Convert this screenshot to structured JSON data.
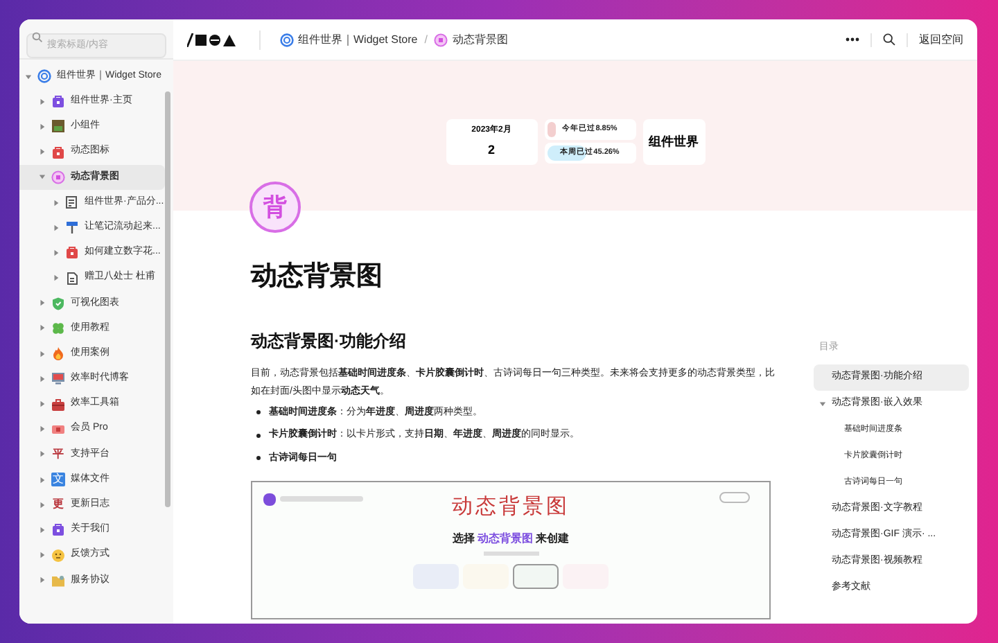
{
  "sidebar": {
    "search_placeholder": "搜索标题/内容",
    "tree": [
      {
        "label": "组件世界｜Widget Store",
        "expanded": true,
        "selected": false,
        "children": [
          {
            "label": "组件世界·主页",
            "expanded": false,
            "selected": false
          },
          {
            "label": "小组件",
            "expanded": false,
            "selected": false
          },
          {
            "label": "动态图标",
            "expanded": false,
            "selected": false
          },
          {
            "label": "动态背景图",
            "expanded": true,
            "selected": true,
            "children": [
              {
                "label": "组件世界·产品分...",
                "expanded": false,
                "selected": false
              },
              {
                "label": "让笔记流动起来...",
                "expanded": false,
                "selected": false
              },
              {
                "label": "如何建立数字花...",
                "expanded": false,
                "selected": false
              },
              {
                "label": "赠卫八处士 杜甫",
                "expanded": false,
                "selected": false
              }
            ]
          },
          {
            "label": "可视化图表",
            "expanded": false,
            "selected": false
          },
          {
            "label": "使用教程",
            "expanded": false,
            "selected": false
          },
          {
            "label": "使用案例",
            "expanded": false,
            "selected": false
          },
          {
            "label": "效率时代博客",
            "expanded": false,
            "selected": false
          },
          {
            "label": "效率工具箱",
            "expanded": false,
            "selected": false
          },
          {
            "label": "会员 Pro",
            "expanded": false,
            "selected": false
          },
          {
            "label": "支持平台",
            "glyph": "平",
            "expanded": false,
            "selected": false
          },
          {
            "label": "媒体文件",
            "glyph": "文",
            "expanded": false,
            "selected": false
          },
          {
            "label": "更新日志",
            "glyph": "更",
            "expanded": false,
            "selected": false
          },
          {
            "label": "关于我们",
            "expanded": false,
            "selected": false
          },
          {
            "label": "反馈方式",
            "expanded": false,
            "selected": false
          },
          {
            "label": "服务协议",
            "expanded": false,
            "selected": false
          }
        ]
      }
    ]
  },
  "topbar": {
    "breadcrumb": [
      "组件世界｜Widget Store",
      "动态背景图"
    ],
    "separator": "/",
    "back_button": "返回空间"
  },
  "cover": {
    "date": {
      "month": "2023年2月",
      "day": "2"
    },
    "progress": [
      {
        "label": "今年已过8.85%",
        "level": 0.0885
      },
      {
        "label": "本周已过45.26%",
        "level": 0.4526
      }
    ],
    "brand": "组件世界"
  },
  "page": {
    "icon_glyph": "背",
    "title": "动态背景图",
    "heading": "动态背景图·功能介绍",
    "intro": "目前，动态背景包括**基础时间进度条**、**卡片胶囊倒计时**、古诗词每日一句三种类型。未来将会支持更多的动态背景类型，比如在封面/头图中显示**动态天气**。",
    "bullets": [
      "**基础时间进度条**：分为**年进度**、**周进度**两种类型。",
      "**卡片胶囊倒计时**：以卡片形式，支持**日期**、**年进度**、**周进度**的同时显示。",
      "**古诗词每日一句**"
    ],
    "embed": {
      "title": "动态背景图",
      "prompt": "选择 **动态背景图** 来创建"
    }
  },
  "toc": {
    "title": "目录",
    "items": [
      {
        "label": "动态背景图·功能介绍",
        "selected": true
      },
      {
        "label": "动态背景图·嵌入效果",
        "selected": false,
        "expanded": true,
        "children": [
          {
            "label": "基础时间进度条",
            "selected": false
          },
          {
            "label": "卡片胶囊倒计时",
            "selected": false
          },
          {
            "label": "古诗词每日一句",
            "selected": false
          }
        ]
      },
      {
        "label": "动态背景图·文字教程",
        "selected": false
      },
      {
        "label": "动态背景图·GIF 演示· ...",
        "selected": false
      },
      {
        "label": "动态背景图·视频教程",
        "selected": false
      },
      {
        "label": "参考文献",
        "selected": false
      }
    ]
  }
}
